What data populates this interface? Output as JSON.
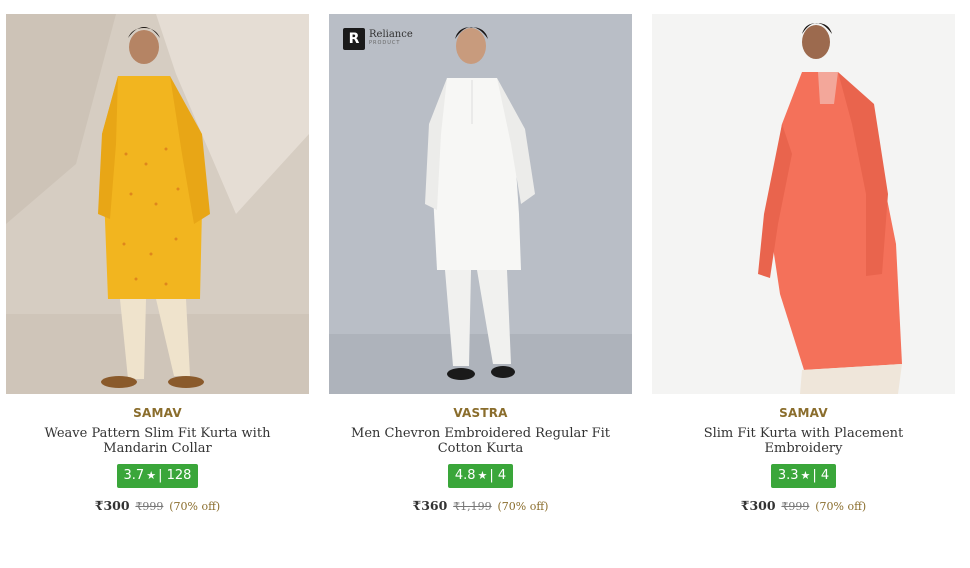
{
  "products": [
    {
      "brand": "SAMAV",
      "title": "Weave Pattern Slim Fit Kurta with Mandarin Collar",
      "rating": "3.7",
      "reviews": "128",
      "price": "₹300",
      "mrp": "₹999",
      "discount": "(70% off)",
      "image_desc": "yellow kurta"
    },
    {
      "brand": "VASTRA",
      "title": "Men Chevron Embroidered Regular Fit Cotton Kurta",
      "rating": "4.8",
      "reviews": "4",
      "price": "₹360",
      "mrp": "₹1,199",
      "discount": "(70% off)",
      "badge_name": "Reliance",
      "badge_sub": "PRODUCT",
      "image_desc": "white kurta"
    },
    {
      "brand": "SAMAV",
      "title": "Slim Fit Kurta with Placement Embroidery",
      "rating": "3.3",
      "reviews": "4",
      "price": "₹300",
      "mrp": "₹999",
      "discount": "(70% off)",
      "image_desc": "coral kurta"
    }
  ],
  "rating_separator": "|",
  "star_glyph": "★",
  "colors": {
    "brand_text": "#8a6d2c",
    "rating_bg": "#3aa63a",
    "discount_text": "#8a6d2c"
  }
}
